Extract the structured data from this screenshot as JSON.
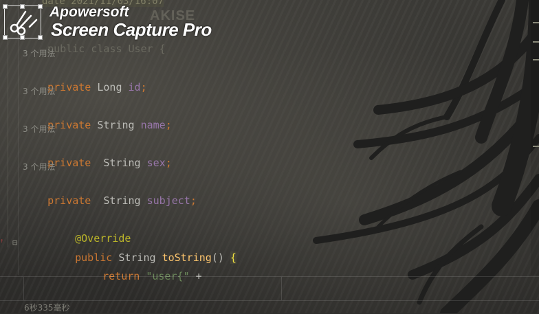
{
  "watermark": {
    "brand": "Apowersoft",
    "product": "Screen Capture Pro",
    "icon": "scissors-icon"
  },
  "top_ghost": {
    "code": "date 2021/11/03/16:07",
    "right": "AKISE"
  },
  "editor": {
    "class_decl_kw": "public class",
    "class_decl_rest": "User {",
    "usage_hint": "3 个用法",
    "fields": [
      {
        "modifier": "private",
        "type": "Long",
        "name": "id",
        "sep": ";"
      },
      {
        "modifier": "private",
        "type": "String",
        "name": "name",
        "sep": ";"
      },
      {
        "modifier": "private ",
        "type": "String",
        "name": "sex",
        "sep": ";"
      },
      {
        "modifier": "private ",
        "type": "String",
        "name": "subject",
        "sep": ";"
      }
    ],
    "annotation": "@Override",
    "method_kw": "public",
    "method_type": "String",
    "method_name": "toString",
    "method_parens": "()",
    "method_brace": "{",
    "return_kw": "return",
    "return_str": "\"user{\"",
    "return_op": "+"
  },
  "status": {
    "elapsed": "6秒335毫秒"
  },
  "colors": {
    "keyword": "#cc7832",
    "field": "#9876aa",
    "annotation": "#bbb529",
    "method": "#ffc66d",
    "string": "#6a8759"
  }
}
